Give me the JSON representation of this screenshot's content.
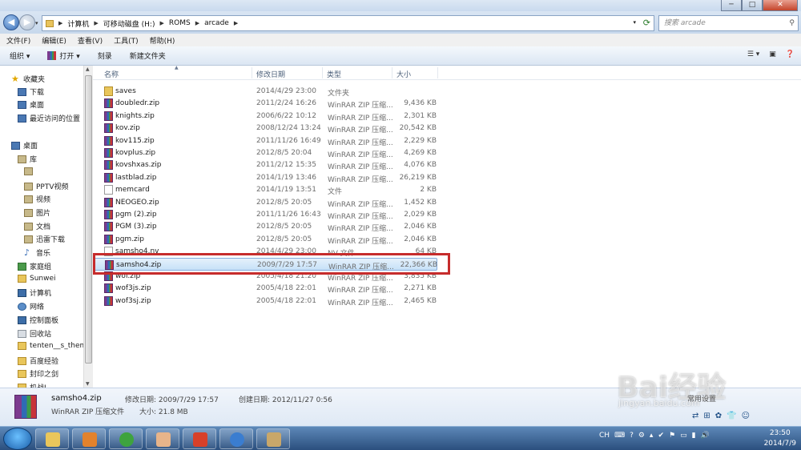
{
  "window": {
    "title_minimize": "─",
    "title_maximize": "□",
    "title_close": "✕"
  },
  "address": {
    "crumbs": [
      "计算机",
      "可移动磁盘 (H:)",
      "ROMS",
      "arcade"
    ],
    "search_placeholder": "搜索 arcade"
  },
  "menu": [
    "文件(F)",
    "编辑(E)",
    "查看(V)",
    "工具(T)",
    "帮助(H)"
  ],
  "toolbar": {
    "organize": "组织 ▾",
    "open": "打开 ▾",
    "burn": "刻录",
    "new_folder": "新建文件夹"
  },
  "nav": [
    {
      "label": "收藏夹",
      "icon": "star"
    },
    {
      "label": "下载",
      "icon": "blue"
    },
    {
      "label": "桌面",
      "icon": "blue"
    },
    {
      "label": "最近访问的位置",
      "icon": "blue"
    },
    {
      "label": "桌面",
      "icon": "blue"
    },
    {
      "label": "库",
      "icon": "lib"
    },
    {
      "label": "",
      "icon": "lib"
    },
    {
      "label": "PPTV视频",
      "icon": "lib"
    },
    {
      "label": "视频",
      "icon": "lib"
    },
    {
      "label": "图片",
      "icon": "lib"
    },
    {
      "label": "文档",
      "icon": "lib"
    },
    {
      "label": "迅雷下载",
      "icon": "lib"
    },
    {
      "label": "音乐",
      "icon": "music"
    },
    {
      "label": "家庭组",
      "icon": "green"
    },
    {
      "label": "Sunwei",
      "icon": "folder"
    },
    {
      "label": "计算机",
      "icon": "pc"
    },
    {
      "label": "网络",
      "icon": "net"
    },
    {
      "label": "控制面板",
      "icon": "pc"
    },
    {
      "label": "回收站",
      "icon": "bin"
    },
    {
      "label": "tenten__s_theme",
      "icon": "folder"
    },
    {
      "label": "百度经验",
      "icon": "folder"
    },
    {
      "label": "封印之剑",
      "icon": "folder"
    },
    {
      "label": "机战J",
      "icon": "folder"
    }
  ],
  "columns": {
    "name": "名称",
    "date": "修改日期",
    "type": "类型",
    "size": "大小"
  },
  "files": [
    {
      "name": "saves",
      "date": "2014/4/29 23:00",
      "type": "文件夹",
      "size": "",
      "icon": "dir"
    },
    {
      "name": "doubledr.zip",
      "date": "2011/2/24 16:26",
      "type": "WinRAR ZIP 压缩...",
      "size": "9,436 KB",
      "icon": "zip"
    },
    {
      "name": "knights.zip",
      "date": "2006/6/22 10:12",
      "type": "WinRAR ZIP 压缩...",
      "size": "2,301 KB",
      "icon": "zip"
    },
    {
      "name": "kov.zip",
      "date": "2008/12/24 13:24",
      "type": "WinRAR ZIP 压缩...",
      "size": "20,542 KB",
      "icon": "zip"
    },
    {
      "name": "kov115.zip",
      "date": "2011/11/26 16:49",
      "type": "WinRAR ZIP 压缩...",
      "size": "2,229 KB",
      "icon": "zip"
    },
    {
      "name": "kovplus.zip",
      "date": "2012/8/5 20:04",
      "type": "WinRAR ZIP 压缩...",
      "size": "4,269 KB",
      "icon": "zip"
    },
    {
      "name": "kovshxas.zip",
      "date": "2011/2/12 15:35",
      "type": "WinRAR ZIP 压缩...",
      "size": "4,076 KB",
      "icon": "zip"
    },
    {
      "name": "lastblad.zip",
      "date": "2014/1/19 13:46",
      "type": "WinRAR ZIP 压缩...",
      "size": "26,219 KB",
      "icon": "zip"
    },
    {
      "name": "memcard",
      "date": "2014/1/19 13:51",
      "type": "文件",
      "size": "2 KB",
      "icon": "doc"
    },
    {
      "name": "NEOGEO.zip",
      "date": "2012/8/5 20:05",
      "type": "WinRAR ZIP 压缩...",
      "size": "1,452 KB",
      "icon": "zip"
    },
    {
      "name": "pgm (2).zip",
      "date": "2011/11/26 16:43",
      "type": "WinRAR ZIP 压缩...",
      "size": "2,029 KB",
      "icon": "zip"
    },
    {
      "name": "PGM (3).zip",
      "date": "2012/8/5 20:05",
      "type": "WinRAR ZIP 压缩...",
      "size": "2,046 KB",
      "icon": "zip"
    },
    {
      "name": "pgm.zip",
      "date": "2012/8/5 20:05",
      "type": "WinRAR ZIP 压缩...",
      "size": "2,046 KB",
      "icon": "zip"
    },
    {
      "name": "samsho4.nv",
      "date": "2014/4/29 23:00",
      "type": "NV 文件",
      "size": "64 KB",
      "icon": "doc"
    },
    {
      "name": "samsho4.zip",
      "date": "2009/7/29 17:57",
      "type": "WinRAR ZIP 压缩...",
      "size": "22,366 KB",
      "icon": "zip",
      "selected": true
    },
    {
      "name": "wof.zip",
      "date": "2005/4/18 21:20",
      "type": "WinRAR ZIP 压缩...",
      "size": "3,835 KB",
      "icon": "zip"
    },
    {
      "name": "wof3js.zip",
      "date": "2005/4/18 22:01",
      "type": "WinRAR ZIP 压缩...",
      "size": "2,271 KB",
      "icon": "zip"
    },
    {
      "name": "wof3sj.zip",
      "date": "2005/4/18 22:01",
      "type": "WinRAR ZIP 压缩...",
      "size": "2,465 KB",
      "icon": "zip"
    }
  ],
  "details": {
    "name": "samsho4.zip",
    "type": "WinRAR ZIP 压缩文件",
    "modified": "修改日期: 2009/7/29 17:57",
    "size": "大小: 21.8 MB",
    "created": "创建日期: 2012/11/27 0:56"
  },
  "watermark": {
    "brand": "Bai经验",
    "url": "jingyan.baidu.com",
    "settings": "常用设置"
  },
  "taskbar": {
    "tray_lang": "CH",
    "time": "23:50",
    "date": "2014/7/9"
  },
  "colors": {
    "selection": "#c6e1f8",
    "highlight_box": "#c62c2c",
    "taskbar": "#2b4f7e"
  }
}
